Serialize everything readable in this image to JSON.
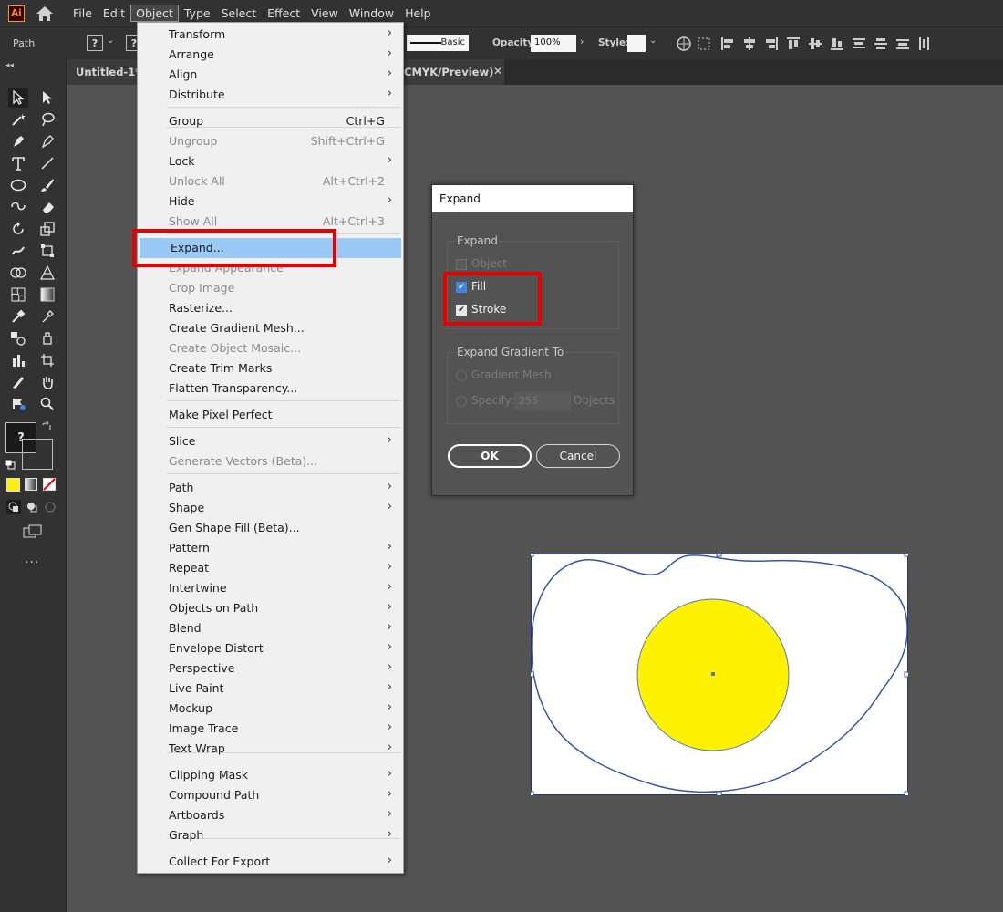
{
  "app": {
    "logo_text": "Ai"
  },
  "menubar": {
    "items": [
      "File",
      "Edit",
      "Object",
      "Type",
      "Select",
      "Effect",
      "View",
      "Window",
      "Help"
    ],
    "active": "Object"
  },
  "control_bar": {
    "selection_type": "Path",
    "fill_value": "?",
    "stroke_profile": "Basic",
    "opacity_label": "Opacity:",
    "opacity_value": "100%",
    "style_label": "Style:"
  },
  "document_tab": {
    "title_start": "Untitled-1* @",
    "title_end": "CMYK/Preview)",
    "close": "✕"
  },
  "toolbar": {
    "collapse": "◂◂",
    "fill_stroke_mark": "?",
    "more": "..."
  },
  "object_menu": {
    "items": [
      {
        "label": "Transform",
        "submenu": true
      },
      {
        "label": "Arrange",
        "submenu": true
      },
      {
        "label": "Align",
        "submenu": true
      },
      {
        "label": "Distribute",
        "submenu": true
      },
      {
        "label": "Group",
        "shortcut": "Ctrl+G"
      },
      {
        "label": "Ungroup",
        "shortcut": "Shift+Ctrl+G",
        "disabled": true
      },
      {
        "label": "Lock",
        "submenu": true
      },
      {
        "label": "Unlock All",
        "shortcut": "Alt+Ctrl+2",
        "disabled": true
      },
      {
        "label": "Hide",
        "submenu": true
      },
      {
        "label": "Show All",
        "shortcut": "Alt+Ctrl+3",
        "disabled": true
      },
      {
        "label": "Expand...",
        "highlighted": true
      },
      {
        "label": "Expand Appearance",
        "disabled": true
      },
      {
        "label": "Crop Image",
        "disabled": true
      },
      {
        "label": "Rasterize..."
      },
      {
        "label": "Create Gradient Mesh..."
      },
      {
        "label": "Create Object Mosaic...",
        "disabled": true
      },
      {
        "label": "Create Trim Marks"
      },
      {
        "label": "Flatten Transparency..."
      },
      {
        "label": "Make Pixel Perfect"
      },
      {
        "label": "Slice",
        "submenu": true
      },
      {
        "label": "Generate Vectors (Beta)...",
        "disabled": true
      },
      {
        "label": "Path",
        "submenu": true
      },
      {
        "label": "Shape",
        "submenu": true
      },
      {
        "label": "Gen Shape Fill (Beta)..."
      },
      {
        "label": "Pattern",
        "submenu": true
      },
      {
        "label": "Repeat",
        "submenu": true
      },
      {
        "label": "Intertwine",
        "submenu": true
      },
      {
        "label": "Objects on Path",
        "submenu": true
      },
      {
        "label": "Blend",
        "submenu": true
      },
      {
        "label": "Envelope Distort",
        "submenu": true
      },
      {
        "label": "Perspective",
        "submenu": true
      },
      {
        "label": "Live Paint",
        "submenu": true
      },
      {
        "label": "Mockup",
        "submenu": true
      },
      {
        "label": "Image Trace",
        "submenu": true
      },
      {
        "label": "Text Wrap",
        "submenu": true
      },
      {
        "label": "Clipping Mask",
        "submenu": true
      },
      {
        "label": "Compound Path",
        "submenu": true
      },
      {
        "label": "Artboards",
        "submenu": true
      },
      {
        "label": "Graph",
        "submenu": true
      },
      {
        "label": "Collect For Export",
        "submenu": true
      }
    ],
    "submenu_arrow": "›"
  },
  "expand_dialog": {
    "title": "Expand",
    "expand_group_label": "Expand",
    "object_label": "Object",
    "object_checked": false,
    "fill_label": "Fill",
    "fill_checked": true,
    "stroke_label": "Stroke",
    "stroke_checked": true,
    "gradient_group_label": "Expand Gradient To",
    "gradient_mesh_label": "Gradient Mesh",
    "specify_label": "Specify:",
    "specify_value": "255",
    "objects_label": "Objects",
    "ok_label": "OK",
    "cancel_label": "Cancel"
  },
  "colors": {
    "accent_highlight": "#99c9f5",
    "annotation_red": "#e80000",
    "yolk": "#fff200",
    "selection_blue": "#3355aa"
  }
}
